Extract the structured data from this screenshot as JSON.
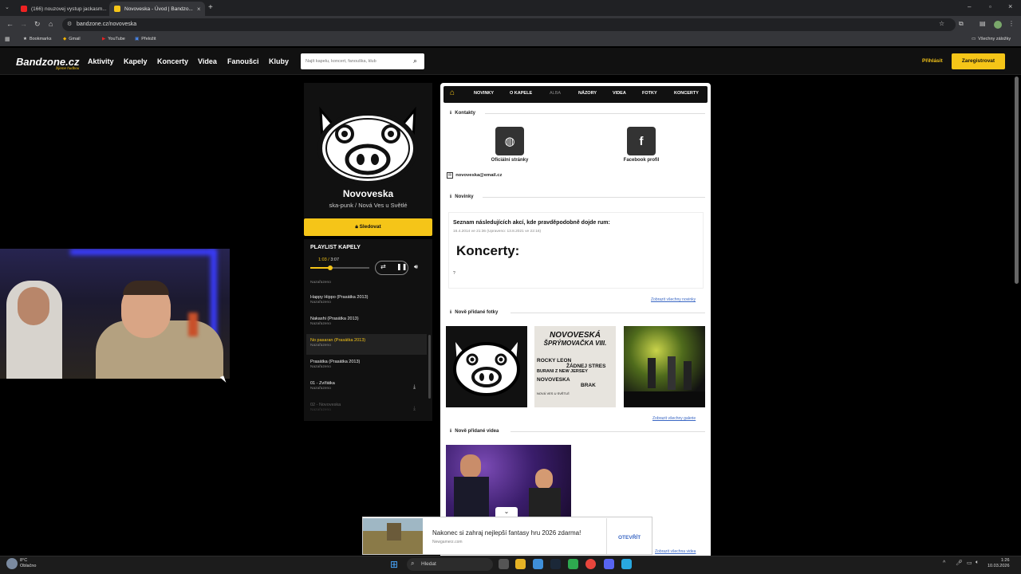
{
  "browser": {
    "tabs": [
      {
        "title": "(166) nouzovej vystup jackasm..."
      },
      {
        "title": "Novoveska - Úvod | Bandzo..."
      }
    ],
    "url": "bandzone.cz/novoveska",
    "bookmarks": [
      "Bookmarks",
      "Gmail",
      "YouTube",
      "Přeložit"
    ],
    "all_bookmarks": "Všechny záložky"
  },
  "site": {
    "logo": "Bandzone.cz",
    "logo_tagline": "žijeme hudbou",
    "nav": [
      "Aktivity",
      "Kapely",
      "Koncerty",
      "Videa",
      "Fanoušci",
      "Kluby"
    ],
    "search_placeholder": "Najít kapelu, koncert, fanouška, klub",
    "login": "Přihlásit",
    "register": "Zaregistrovat"
  },
  "band": {
    "name": "Novoveska",
    "genre": "ska-punk / Nová Ves u Světlé",
    "follow": "Sledovat"
  },
  "playlist": {
    "title": "PLAYLIST KAPELY",
    "current_time": "1:03",
    "duration": "3:07",
    "progress": 0.34,
    "tracks": [
      {
        "title": "",
        "status": "Nazařazeno"
      },
      {
        "title": "Happy Hippo (Prasátka 2013)",
        "status": "Nazařazeno"
      },
      {
        "title": "Nakashi (Prasátka 2013)",
        "status": "Nazařazeno"
      },
      {
        "title": "No pasaran (Prasátka 2013)",
        "status": "Nazařazeno"
      },
      {
        "title": "Prasátka (Prasátka 2013)",
        "status": "Nazařazeno"
      },
      {
        "title": "01 - Zvířátka",
        "status": "Nazařazeno"
      },
      {
        "title": "02 - Novoveska",
        "status": "Nazařazeno"
      }
    ]
  },
  "content": {
    "tabs": [
      "NOVINKY",
      "O KAPELE",
      "ALBA",
      "NÁZORY",
      "VIDEA",
      "FOTKY",
      "KONCERTY"
    ],
    "contacts_heading": "Kontakty",
    "website_label": "Oficiální stránky",
    "facebook_label": "Facebook profil",
    "email": "novoveska@email.cz",
    "news_heading": "Novinky",
    "news_title": "Seznam následujících akcí, kde pravděpodobně dojde rum:",
    "news_date": "16.4.2014 ve 21:36    (Upraveno: 13.8.2021 ve 22:16)",
    "news_big": "Koncerty:",
    "news_q": "?",
    "all_news": "Zobrazit všechny novinky",
    "photos_heading": "Nově přidané fotky",
    "poster_lines": [
      "NOVOVESKÁ",
      "ŠPRÝMOVAČKA VIII.",
      "ROCKY LEON",
      "ŽÁDNEJ STRES",
      "BURANI Z NEW JERSEY",
      "NOVOVESKA",
      "BRAK",
      "NOVÁ VES U SVĚTLÉ"
    ],
    "all_galleries": "Zobrazit všechny galerie",
    "videos_heading": "Nově přidané videa",
    "all_videos": "Zobrazit všechna videa"
  },
  "ad": {
    "title": "Nakonec si zahraj nejlepší fantasy hru 2026 zdarma!",
    "source": "Newgamerz.com",
    "cta": "OTEVŘÍT"
  },
  "taskbar": {
    "search": "Hledat",
    "weather_temp": "8°C",
    "weather_text": "Oblačno",
    "time": "1:26",
    "date": "10.03.2026"
  }
}
